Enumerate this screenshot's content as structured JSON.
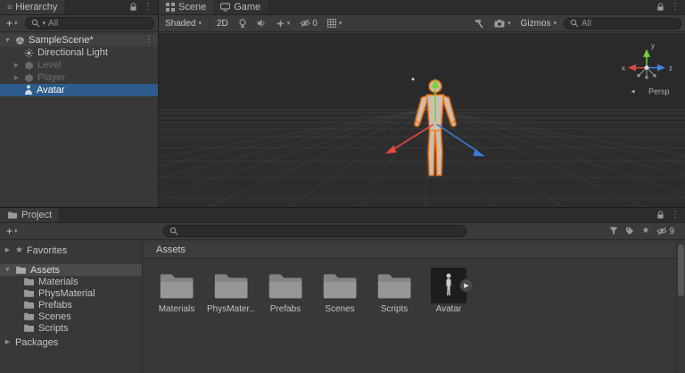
{
  "icons": {
    "caret": "▾",
    "kebab": "⋮",
    "star": "★",
    "play": "▶",
    "collapsed": "▶",
    "expanded": "▼",
    "plus": "+",
    "hamburger": "≡",
    "persp_chevron": "◄"
  },
  "hierarchy": {
    "tab_label": "Hierarchy",
    "search_value": "All",
    "scene_name": "SampleScene*",
    "items": [
      {
        "label": "Directional Light"
      },
      {
        "label": "Level"
      },
      {
        "label": "Player"
      },
      {
        "label": "Avatar"
      }
    ]
  },
  "scene_view": {
    "tab_scene": "Scene",
    "tab_game": "Game",
    "shading_mode": "Shaded",
    "mode_2d": "2D",
    "hidden_count": "0",
    "gizmos_label": "Gizmos",
    "search_value": "All",
    "persp_label": "Persp",
    "axis_x": "x",
    "axis_y": "y",
    "axis_z": "z"
  },
  "project": {
    "tab_label": "Project",
    "search_value": "",
    "hidden_packages_count": "9",
    "favorites_label": "Favorites",
    "assets_label": "Assets",
    "packages_label": "Packages",
    "breadcrumb": "Assets",
    "tree_folders": [
      {
        "label": "Materials"
      },
      {
        "label": "PhysMaterial"
      },
      {
        "label": "Prefabs"
      },
      {
        "label": "Scenes"
      },
      {
        "label": "Scripts"
      }
    ],
    "items": [
      {
        "label": "Materials",
        "type": "folder"
      },
      {
        "label": "PhysMater...",
        "type": "folder"
      },
      {
        "label": "Prefabs",
        "type": "folder"
      },
      {
        "label": "Scenes",
        "type": "folder"
      },
      {
        "label": "Scripts",
        "type": "folder"
      },
      {
        "label": "Avatar",
        "type": "model"
      }
    ]
  }
}
